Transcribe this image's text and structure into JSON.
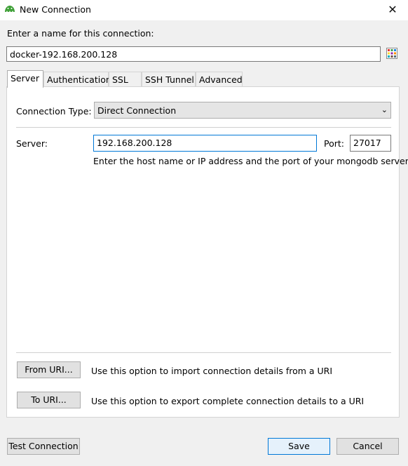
{
  "window": {
    "title": "New Connection",
    "close_glyph": "✕"
  },
  "name_section": {
    "label": "Enter a name for this connection:",
    "value": "docker-192.168.200.128"
  },
  "icons": {
    "app": "mongodb-leaf-icon",
    "color_picker": "color-grid-icon",
    "close": "close-icon"
  },
  "tabs": [
    {
      "label": "Server",
      "active": true
    },
    {
      "label": "Authentication"
    },
    {
      "label": "SSL"
    },
    {
      "label": "SSH Tunnel"
    },
    {
      "label": "Advanced"
    }
  ],
  "server_tab": {
    "connection_type_label": "Connection Type:",
    "connection_type_value": "Direct Connection",
    "server_label": "Server:",
    "server_value": "192.168.200.128",
    "port_label": "Port:",
    "port_value": "27017",
    "hint": "Enter the host name or IP address and the port of your mongodb server",
    "from_uri_button": "From URI...",
    "from_uri_text": "Use this option to import connection details from a URI",
    "to_uri_button": "To URI...",
    "to_uri_text": "Use this option to export complete connection details to a URI"
  },
  "footer": {
    "test_button": "Test Connection",
    "save_button": "Save",
    "cancel_button": "Cancel"
  },
  "colors": {
    "accent": "#0078d7",
    "app_icon": "#3fa037"
  }
}
